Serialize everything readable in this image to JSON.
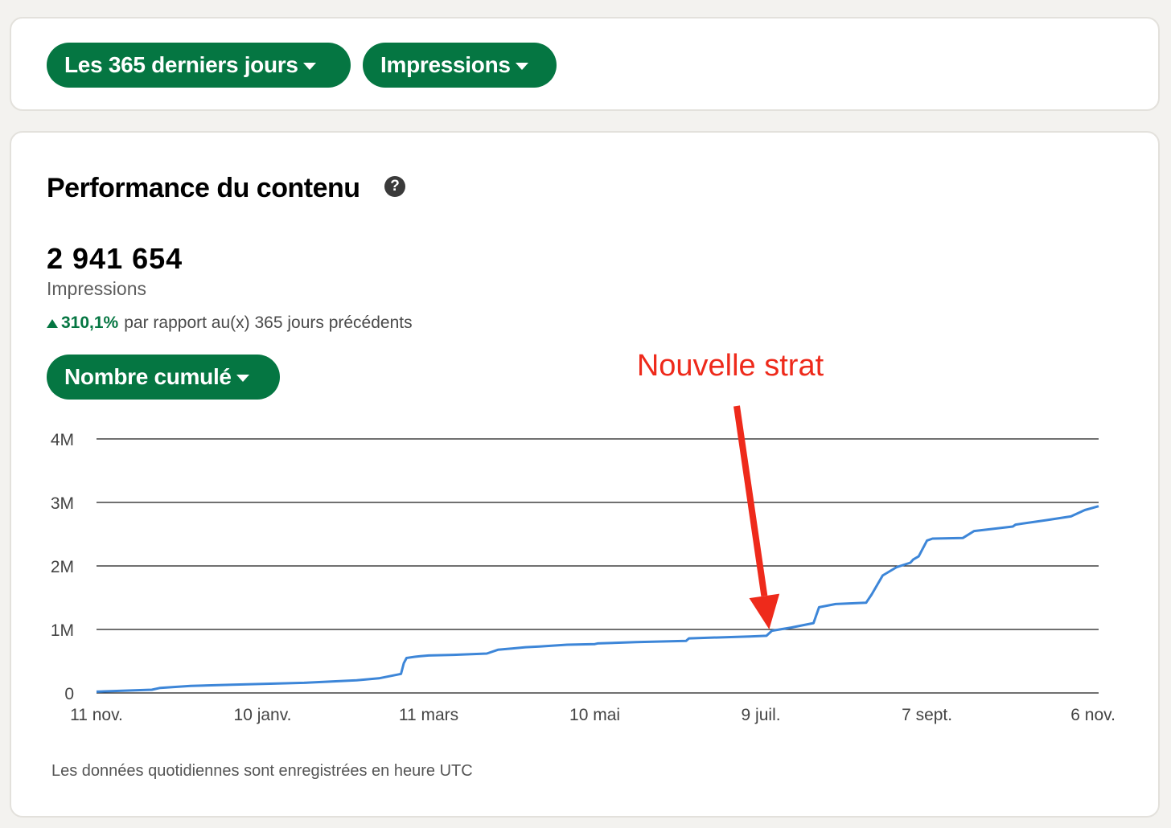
{
  "filters": {
    "period_label": "Les 365 derniers jours",
    "metric_label": "Impressions"
  },
  "performance": {
    "title": "Performance du contenu",
    "help_icon": "question-circle-icon",
    "total_value": "2 941 654",
    "total_label": "Impressions",
    "change_value": "310,1%",
    "change_text": "par rapport au(x) 365 jours précédents",
    "mode_label": "Nombre cumulé",
    "footnote": "Les données quotidiennes sont enregistrées en heure UTC"
  },
  "annotation": {
    "text": "Nouvelle strat",
    "color": "#ee2a1b",
    "target_date": "2023-07-12",
    "target_value": 900000
  },
  "colors": {
    "brand": "#057642",
    "line": "#3d86d8"
  },
  "chart_data": {
    "type": "line",
    "title": "",
    "xlabel": "",
    "ylabel": "",
    "ylim": [
      0,
      4000000
    ],
    "y_ticks": [
      0,
      1000000,
      2000000,
      3000000,
      4000000
    ],
    "y_tick_labels": [
      "0",
      "1M",
      "2M",
      "3M",
      "4M"
    ],
    "xlim": [
      "2022-11-11",
      "2023-11-08"
    ],
    "x_ticks": [
      "2022-11-11",
      "2023-01-10",
      "2023-03-11",
      "2023-05-10",
      "2023-07-09",
      "2023-09-07",
      "2023-11-06"
    ],
    "x_tick_labels": [
      "11 nov.",
      "10 janv.",
      "11 mars",
      "10 mai",
      "9 juil.",
      "7 sept.",
      "6 nov."
    ],
    "grid": true,
    "series": [
      {
        "x": [
          "2022-11-11",
          "2022-12-01",
          "2022-12-04",
          "2022-12-15",
          "2022-12-30",
          "2023-01-25",
          "2023-02-13",
          "2023-02-21",
          "2023-03-01",
          "2023-03-02",
          "2023-03-03",
          "2023-03-06",
          "2023-03-08",
          "2023-03-11",
          "2023-03-20",
          "2023-04-01",
          "2023-04-05",
          "2023-04-15",
          "2023-04-20",
          "2023-04-30",
          "2023-05-10",
          "2023-05-11",
          "2023-05-25",
          "2023-06-12",
          "2023-06-13",
          "2023-07-05",
          "2023-07-11",
          "2023-07-13",
          "2023-07-20",
          "2023-07-28",
          "2023-07-30",
          "2023-08-05",
          "2023-08-16",
          "2023-08-18",
          "2023-08-22",
          "2023-08-27",
          "2023-09-01",
          "2023-09-02",
          "2023-09-04",
          "2023-09-07",
          "2023-09-09",
          "2023-09-20",
          "2023-09-24",
          "2023-10-08",
          "2023-10-09",
          "2023-10-20",
          "2023-10-29",
          "2023-11-03",
          "2023-11-08"
        ],
        "y": [
          20000,
          50000,
          80000,
          110000,
          130000,
          160000,
          200000,
          230000,
          300000,
          470000,
          550000,
          570000,
          580000,
          590000,
          600000,
          620000,
          680000,
          720000,
          730000,
          760000,
          770000,
          780000,
          800000,
          820000,
          860000,
          890000,
          900000,
          980000,
          1030000,
          1100000,
          1350000,
          1400000,
          1420000,
          1550000,
          1850000,
          1980000,
          2050000,
          2100000,
          2150000,
          2400000,
          2430000,
          2440000,
          2550000,
          2620000,
          2650000,
          2720000,
          2780000,
          2880000,
          2940000
        ]
      }
    ]
  }
}
